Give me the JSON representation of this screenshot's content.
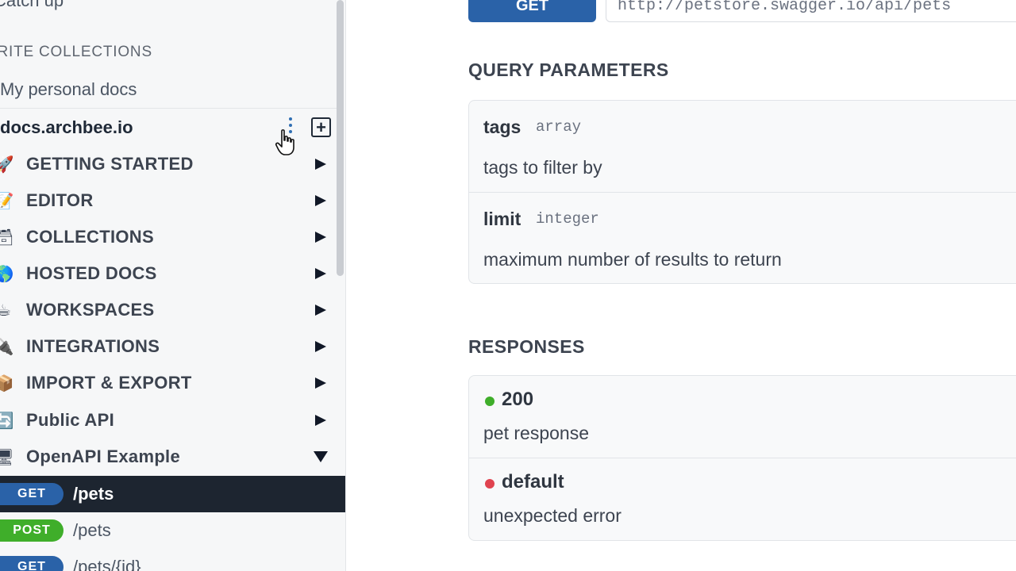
{
  "sidebar": {
    "catch_up": "Catch up",
    "favorite_heading": "FAVORITE COLLECTIONS",
    "personal_docs": "My personal docs",
    "workspace": "docs.archbee.io",
    "add_label": "+",
    "nav": [
      {
        "emoji": "🚀",
        "label": "GETTING STARTED",
        "icon": "rocket-icon",
        "expanded": false
      },
      {
        "emoji": "📝",
        "label": "EDITOR",
        "icon": "memo-icon",
        "expanded": false
      },
      {
        "emoji": "🗃",
        "label": "COLLECTIONS",
        "icon": "card-box-icon",
        "expanded": false
      },
      {
        "emoji": "🌎",
        "label": "HOSTED DOCS",
        "icon": "globe-icon",
        "expanded": false
      },
      {
        "emoji": "☕",
        "label": "WORKSPACES",
        "icon": "coffee-icon",
        "expanded": false
      },
      {
        "emoji": "🔌",
        "label": "INTEGRATIONS",
        "icon": "plug-icon",
        "expanded": false
      },
      {
        "emoji": "📦",
        "label": "IMPORT & EXPORT",
        "icon": "package-icon",
        "expanded": false
      },
      {
        "emoji": "🔄",
        "label": "Public API",
        "icon": "refresh-icon",
        "expanded": false
      },
      {
        "emoji": "🖥",
        "label": "OpenAPI Example",
        "icon": "desktop-icon",
        "expanded": true
      }
    ],
    "endpoints": [
      {
        "method": "GET",
        "path": "/pets",
        "active": true
      },
      {
        "method": "POST",
        "path": "/pets",
        "active": false
      },
      {
        "method": "GET",
        "path": "/pets/{id}",
        "active": false
      }
    ]
  },
  "main": {
    "method": "GET",
    "url": "http://petstore.swagger.io/api/pets",
    "query_title": "QUERY PARAMETERS",
    "params": [
      {
        "name": "tags",
        "type": "array",
        "description": "tags to filter by"
      },
      {
        "name": "limit",
        "type": "integer",
        "description": "maximum number of results to return"
      }
    ],
    "responses_title": "RESPONSES",
    "responses": [
      {
        "code": "200",
        "description": "pet response",
        "color": "#3fae2a"
      },
      {
        "code": "default",
        "description": "unexpected error",
        "color": "#e0434f"
      }
    ]
  },
  "colors": {
    "get": "#2a62a8",
    "post": "#3fae2a",
    "active_row": "#1d2530"
  }
}
